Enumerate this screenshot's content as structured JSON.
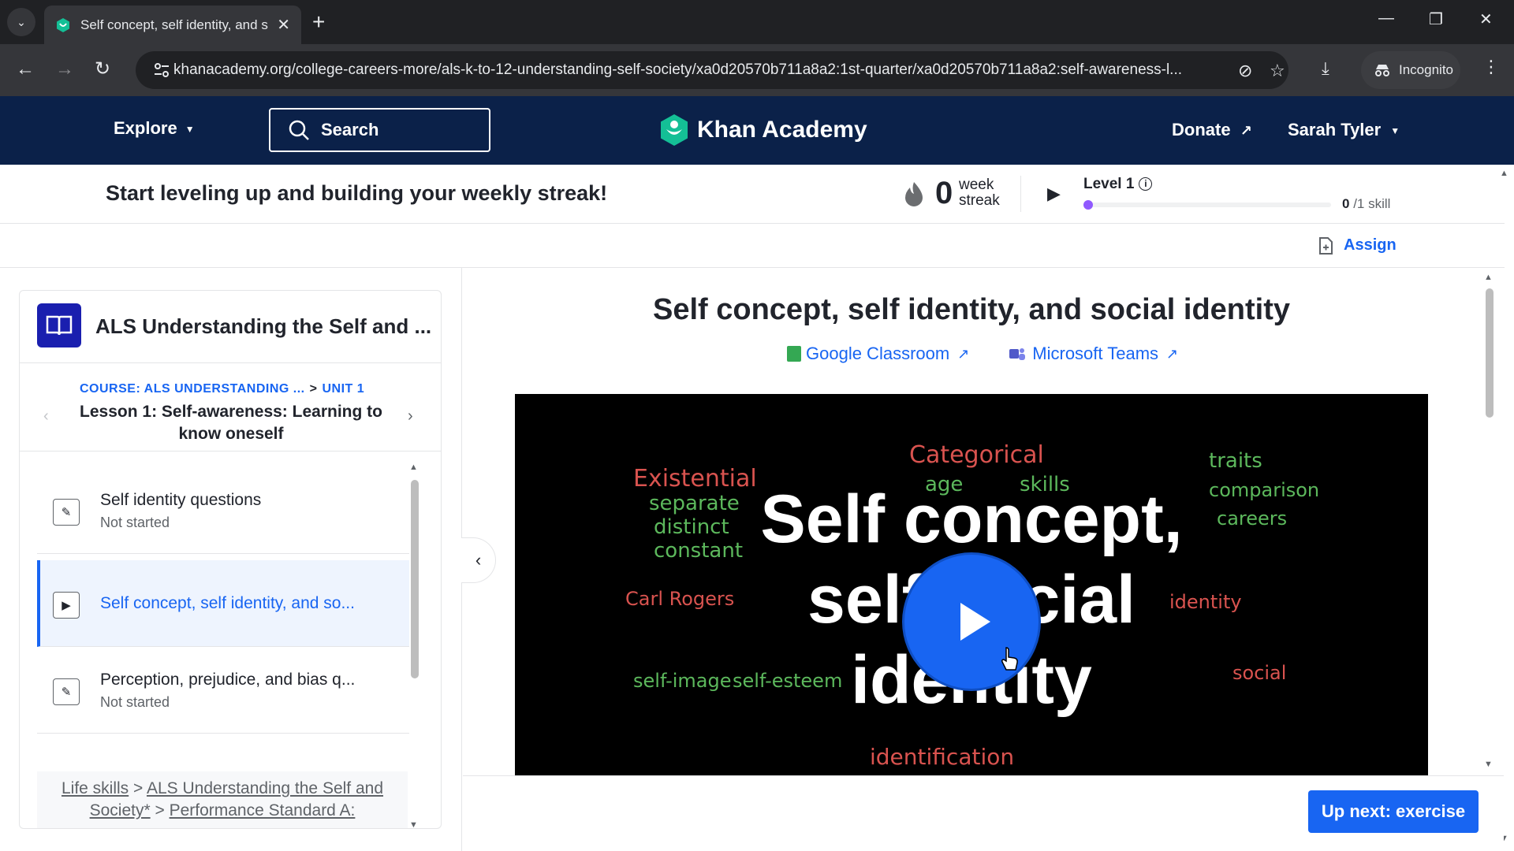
{
  "browser": {
    "tab_title": "Self concept, self identity, and s",
    "url": "khanacademy.org/college-careers-more/als-k-to-12-understanding-self-society/xa0d20570b711a8a2:1st-quarter/xa0d20570b711a8a2:self-awareness-l...",
    "incognito_label": "Incognito"
  },
  "header": {
    "explore_label": "Explore",
    "search_label": "Search",
    "logo_text": "Khan Academy",
    "donate_label": "Donate",
    "user_name": "Sarah Tyler"
  },
  "streak": {
    "message": "Start leveling up and building your weekly streak!",
    "count": "0",
    "unit_line1": "week",
    "unit_line2": "streak",
    "level_label": "Level 1",
    "skills_done": "0",
    "skills_total": "/1 skill",
    "level_progress": 0
  },
  "assign_label": "Assign",
  "sidebar": {
    "course_title": "ALS Understanding the Self and ...",
    "crumb_course": "COURSE: ALS UNDERSTANDING ...",
    "crumb_sep": ">",
    "crumb_unit": "UNIT 1",
    "lesson_title": "Lesson 1: Self-awareness: Learning to know oneself",
    "items": [
      {
        "name": "Self identity questions",
        "status": "Not started",
        "type": "exercise"
      },
      {
        "name": "Self concept, self identity, and so...",
        "status": "",
        "type": "video"
      },
      {
        "name": "Perception, prejudice, and bias q...",
        "status": "Not started",
        "type": "exercise"
      }
    ],
    "bottom_crumbs": {
      "life_skills": "Life skills",
      "course": "ALS Understanding the Self and Society*",
      "standard": "Performance Standard A:"
    }
  },
  "main": {
    "video_title": "Self concept, self identity, and social identity",
    "google_classroom": "Google Classroom",
    "microsoft_teams": "Microsoft Teams",
    "video_overlay": {
      "line1": "Self concept,",
      "line2": "self social",
      "line3": "identity"
    },
    "chalk_words": [
      "Existential",
      "separate",
      "distinct",
      "constant",
      "Categorical",
      "age",
      "skills",
      "traits",
      "comparison",
      "careers",
      "Carl Rogers",
      "self-image",
      "self-esteem",
      "identity",
      "social",
      "identification"
    ],
    "up_next_label": "Up next: exercise"
  },
  "colors": {
    "ka_navy": "#0b2149",
    "ka_blue": "#1865f2",
    "level_purple": "#9059ff",
    "chrome_dark": "#202124"
  }
}
